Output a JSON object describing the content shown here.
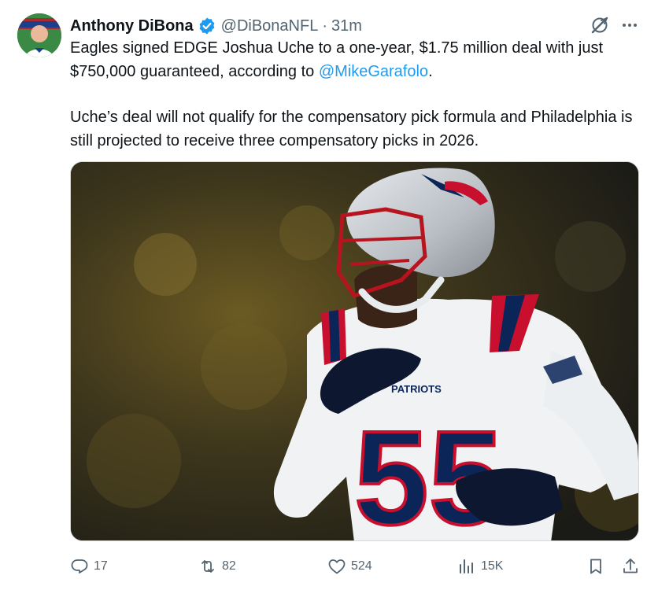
{
  "tweet": {
    "author": {
      "name": "Anthony DiBona",
      "handle": "@DiBonaNFL",
      "verified": true,
      "avatar": "avatar-image"
    },
    "separator": "·",
    "time": "31m",
    "text": {
      "p1_before": "Eagles signed EDGE Joshua Uche to a one-year, $1.75 million deal with just $750,000 guaranteed, according to ",
      "mention": "@MikeGarafolo",
      "p1_after": ".",
      "p2": "Uche’s deal will not qualify for the compensatory pick formula and Philadelphia is still projected to receive three compensatory picks in 2026."
    },
    "media": {
      "type": "photo",
      "jersey_text": "PATRIOTS",
      "jersey_number": "55"
    },
    "actions": {
      "replies": "17",
      "reposts": "82",
      "likes": "524",
      "views": "15K"
    },
    "icons": [
      "verified-badge-icon",
      "grok-icon",
      "more-icon",
      "reply-icon",
      "repost-icon",
      "like-icon",
      "views-icon",
      "bookmark-icon",
      "share-icon"
    ],
    "colors": {
      "text": "#0f1419",
      "secondary": "#536471",
      "link": "#1d9bf0",
      "verified": "#1d9bf0"
    }
  }
}
